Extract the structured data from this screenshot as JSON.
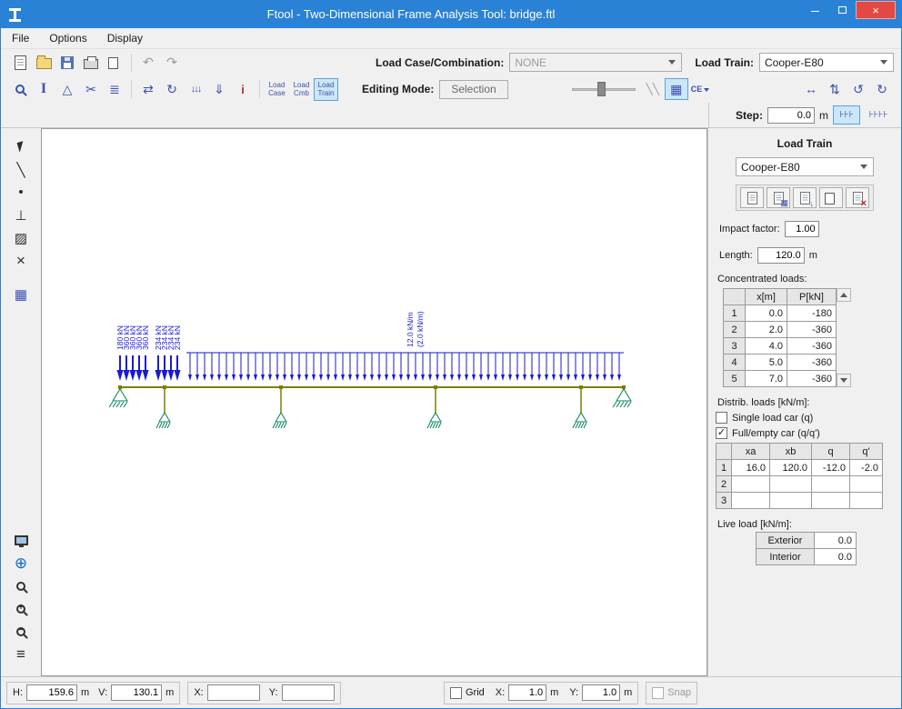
{
  "window": {
    "title": "Ftool - Two-Dimensional Frame Analysis Tool: bridge.ftl"
  },
  "menu": {
    "file": "File",
    "options": "Options",
    "display": "Display"
  },
  "toolbar1": {
    "load_case_label": "Load Case/Combination:",
    "load_case_value": "NONE",
    "load_train_label": "Load Train:",
    "load_train_value": "Cooper-E80"
  },
  "toolbar2": {
    "load_case_btn": [
      "Load",
      "Case"
    ],
    "load_cmb_btn": [
      "Load",
      "Cmb"
    ],
    "load_train_btn": [
      "Load",
      "Train"
    ],
    "editing_mode_label": "Editing Mode:",
    "editing_mode_value": "Selection",
    "ce_label": "CE"
  },
  "step": {
    "label": "Step:",
    "value": "0.0",
    "unit": "m"
  },
  "panel": {
    "title": "Load Train",
    "train_name": "Cooper-E80",
    "impact_label": "Impact factor:",
    "impact_value": "1.00",
    "length_label": "Length:",
    "length_value": "120.0",
    "length_unit": "m",
    "conc_title": "Concentrated loads:",
    "conc_headers": [
      "x[m]",
      "P[kN]"
    ],
    "conc_rows": [
      {
        "n": "1",
        "x": "0.0",
        "p": "-180"
      },
      {
        "n": "2",
        "x": "2.0",
        "p": "-360"
      },
      {
        "n": "3",
        "x": "4.0",
        "p": "-360"
      },
      {
        "n": "4",
        "x": "5.0",
        "p": "-360"
      },
      {
        "n": "5",
        "x": "7.0",
        "p": "-360"
      }
    ],
    "distrib_title": "Distrib. loads [kN/m]:",
    "single_car_label": "Single load car (q)",
    "full_car_label": "Full/empty car (q/q')",
    "distrib_headers": [
      "xa",
      "xb",
      "q",
      "q'"
    ],
    "distrib_rows": [
      {
        "n": "1",
        "xa": "16.0",
        "xb": "120.0",
        "q": "-12.0",
        "qp": "-2.0"
      },
      {
        "n": "2",
        "xa": "",
        "xb": "",
        "q": "",
        "qp": ""
      },
      {
        "n": "3",
        "xa": "",
        "xb": "",
        "q": "",
        "qp": ""
      }
    ],
    "live_title": "Live load [kN/m]:",
    "live_rows": [
      {
        "label": "Exterior",
        "value": "0.0"
      },
      {
        "label": "Interior",
        "value": "0.0"
      }
    ]
  },
  "canvas": {
    "conc_labels": [
      "180 kN",
      "360 kN",
      "360 kN",
      "360 kN",
      "360 kN",
      "234 kN",
      "234 kN",
      "234 kN",
      "234 kN"
    ],
    "dist_label_main": "12.0 kN/m",
    "dist_label_alt": "(2.0 kN/m)",
    "colors": {
      "load": "#1a1acd",
      "beam": "#7e7e00",
      "support": "#00805a"
    }
  },
  "statusbar": {
    "h_label": "H:",
    "h_value": "159.6",
    "h_unit": "m",
    "v_label": "V:",
    "v_value": "130.1",
    "v_unit": "m",
    "x_label": "X:",
    "x_value": "",
    "y_label": "Y:",
    "y_value": "",
    "grid_label": "Grid",
    "grid_x_label": "X:",
    "grid_x_value": "1.0",
    "grid_x_unit": "m",
    "grid_y_label": "Y:",
    "grid_y_value": "1.0",
    "grid_y_unit": "m",
    "snap_label": "Snap"
  }
}
